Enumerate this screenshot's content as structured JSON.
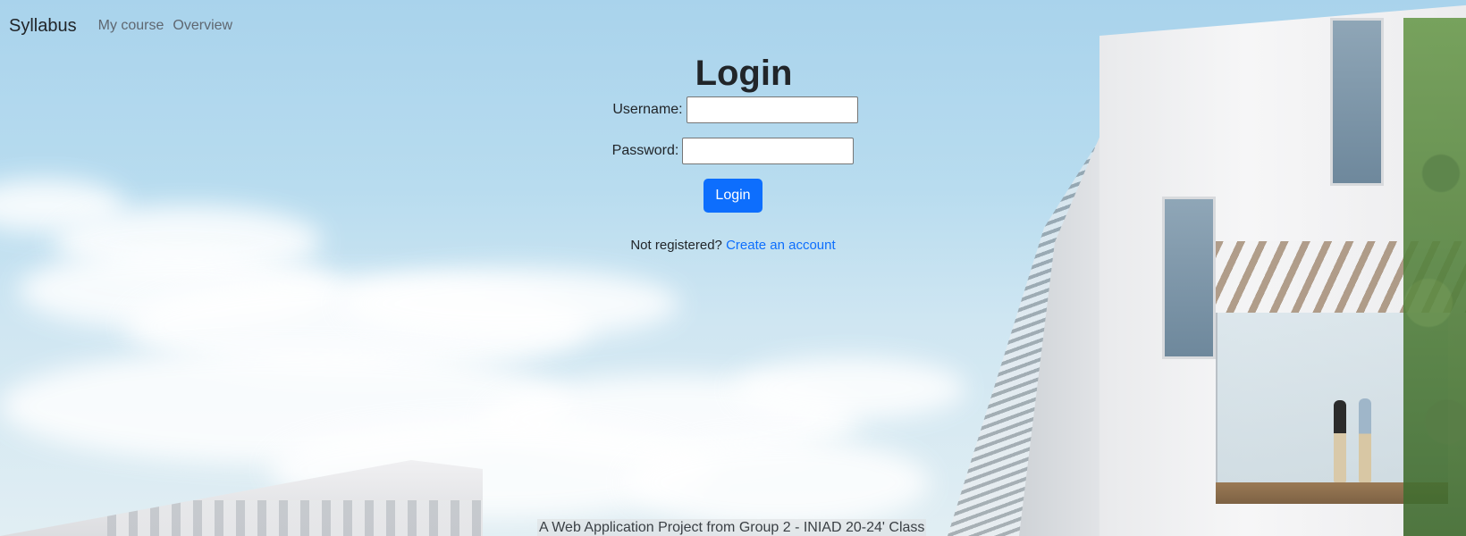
{
  "navbar": {
    "brand": "Syllabus",
    "links": [
      {
        "label": "My course"
      },
      {
        "label": "Overview"
      }
    ]
  },
  "login": {
    "title": "Login",
    "username_label": "Username:",
    "username_value": "",
    "password_label": "Password:",
    "password_value": "",
    "submit_label": "Login",
    "not_registered_text": "Not registered?",
    "create_account_label": "Create an account"
  },
  "footer": {
    "text": "A Web Application Project from Group 2 - INIAD 20-24' Class"
  },
  "colors": {
    "primary": "#0d6efd",
    "sky": "#a9d3ec"
  }
}
